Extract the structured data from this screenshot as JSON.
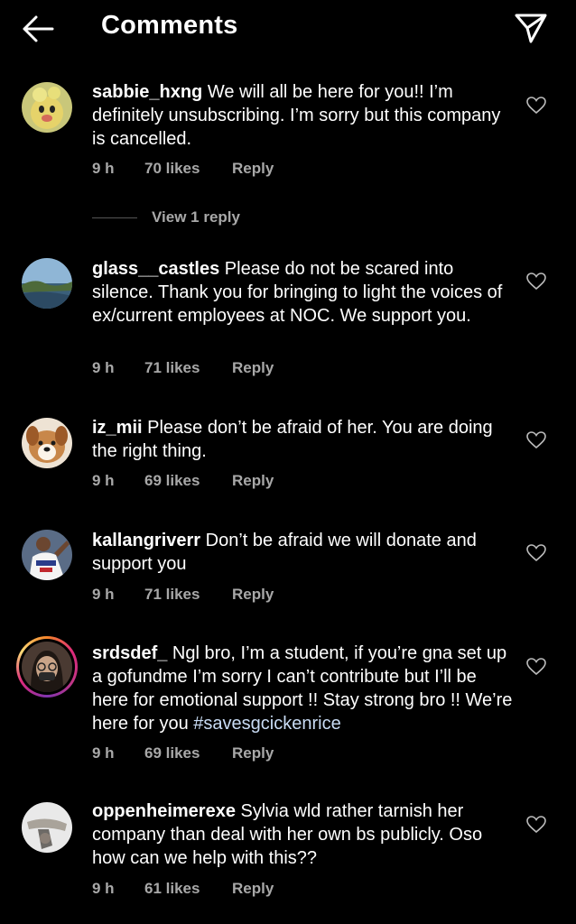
{
  "header": {
    "title": "Comments",
    "back_icon": "arrow-left-icon",
    "send_icon": "paper-plane-icon"
  },
  "comments": [
    {
      "username": "sabbie_hxng",
      "text": " We will all be here for you!! I’m definitely unsubscribing. I’m sorry but this company is cancelled.",
      "time": "9 h",
      "likes": "70 likes",
      "reply": "Reply",
      "view_replies": "View 1 reply"
    },
    {
      "username": "glass__castles",
      "text": " Please do not be scared into silence. Thank you for bringing to light the voices of ex/current employees at NOC. We support you.",
      "time": "9 h",
      "likes": "71 likes",
      "reply": "Reply"
    },
    {
      "username": "iz_mii",
      "text": " Please don’t be afraid of her. You are doing the right thing.",
      "time": "9 h",
      "likes": "69 likes",
      "reply": "Reply"
    },
    {
      "username": "kallangriverr",
      "text": " Don’t be afraid we will donate and support you",
      "time": "9 h",
      "likes": "71 likes",
      "reply": "Reply"
    },
    {
      "username": "srdsdef_",
      "text": " Ngl bro, I’m a student, if you’re gna set up a gofundme I’m sorry I can’t contribute but I’ll be here for emotional support !! Stay strong bro !! We’re here for you ",
      "hashtag": "#savesgcickenrice",
      "time": "9 h",
      "likes": "69 likes",
      "reply": "Reply"
    },
    {
      "username": "oppenheimerexe",
      "text": " Sylvia wld rather tarnish her company than deal with her own bs publicly. Oso how can we help with this??",
      "time": "9 h",
      "likes": "61 likes",
      "reply": "Reply"
    }
  ]
}
